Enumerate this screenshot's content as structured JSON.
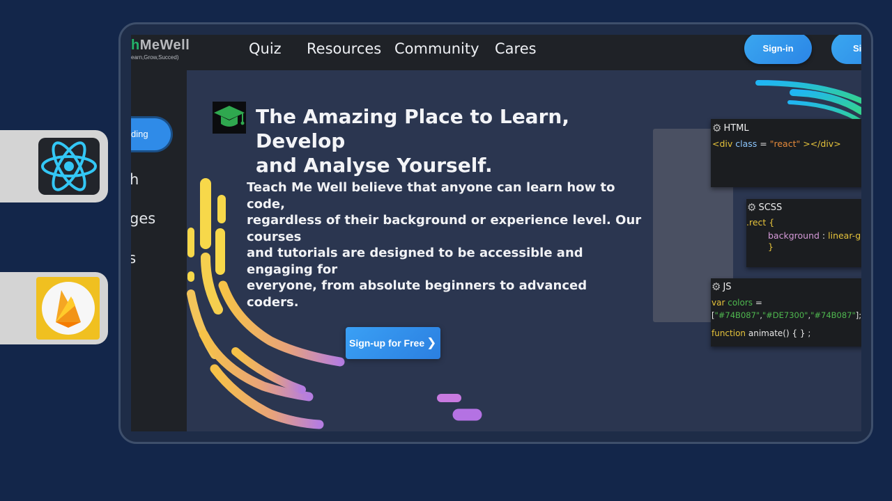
{
  "logo": {
    "prefix": "h",
    "name": "MeWell",
    "tagline": "earn,Grow,Succed)"
  },
  "nav": {
    "links": [
      "Quiz",
      "Resources",
      "Community",
      "Cares"
    ],
    "signin_label": "Sign-in",
    "signup_label": "Si"
  },
  "sidebar": {
    "active_label": "ding",
    "items": [
      "h",
      "ges",
      "ts"
    ]
  },
  "hero": {
    "headline_line1": "The Amazing Place to Learn, Develop",
    "headline_line2": "and Analyse Yourself.",
    "description_lines": [
      "Teach Me Well believe that anyone can learn how to code,",
      "regardless of their background or experience level. Our courses",
      "and tutorials are designed to be accessible and engaging for",
      "everyone, from absolute beginners to advanced",
      "coders."
    ],
    "cta_label": "Sign-up for Free"
  },
  "code_panels": {
    "html": {
      "title": "HTML",
      "line_tag": "<div",
      "line_attr": "class",
      "line_eq": "=",
      "line_val": "\"react\"",
      "line_end": "></div>"
    },
    "scss": {
      "title": "SCSS",
      "selector": ".rect {",
      "prop": "background",
      "colon": ":",
      "value": "linear-gr",
      "close": "}"
    },
    "js": {
      "title": "JS",
      "kw_var": "var",
      "var_name": "colors",
      "eq": "=",
      "array_open": "[",
      "c1": "\"#74B087\"",
      "c2": "\"#DE7300\"",
      "c3": "\"#74B087\"",
      "array_close": "];",
      "kw_function": "function",
      "fn_name": "animate() { } ;"
    }
  },
  "icons": {
    "react": "react-logo-icon",
    "firebase": "firebase-logo-icon",
    "gear": "gear-icon",
    "grad_cap": "graduation-cap-icon",
    "chevron": "chevron-right-icon"
  },
  "colors": {
    "page_bg": "#13264a",
    "accent_blue": "#2f8be8",
    "stripe_yellow": "#f5d442",
    "stripe_cyan": "#27c7f2",
    "stripe_teal": "#2ecf9a"
  }
}
